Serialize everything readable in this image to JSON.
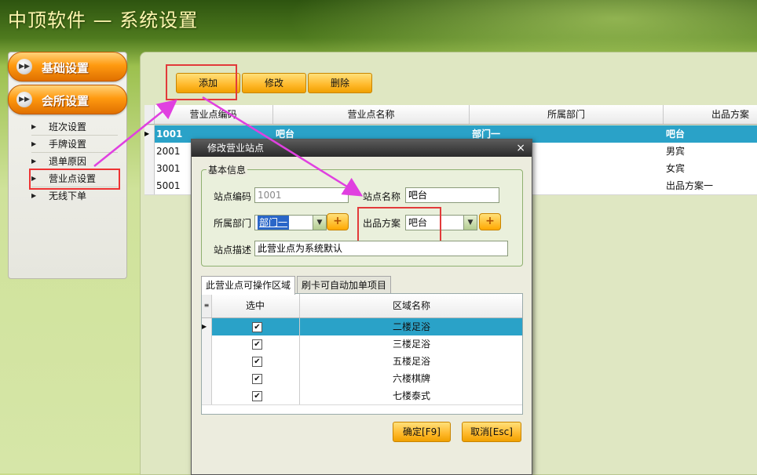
{
  "app": {
    "title": "中顶软件 — 系统设置"
  },
  "sidebar": {
    "groups": [
      {
        "label": "基础设置"
      },
      {
        "label": "会所设置"
      }
    ],
    "items": [
      {
        "label": "班次设置"
      },
      {
        "label": "手牌设置"
      },
      {
        "label": "退单原因"
      },
      {
        "label": "营业点设置"
      },
      {
        "label": "无线下单"
      }
    ]
  },
  "toolbar": {
    "add": "添加",
    "edit": "修改",
    "delete": "删除"
  },
  "grid": {
    "columns": [
      "营业点编码",
      "营业点名称",
      "所属部门",
      "出品方案"
    ],
    "rows": [
      {
        "code": "1001",
        "name": "吧台",
        "dept": "部门一",
        "plan": "吧台"
      },
      {
        "code": "2001",
        "name": "",
        "dept": "",
        "plan": "男宾"
      },
      {
        "code": "3001",
        "name": "",
        "dept": "",
        "plan": "女宾"
      },
      {
        "code": "5001",
        "name": "",
        "dept": "",
        "plan": "出品方案一"
      }
    ]
  },
  "dialog": {
    "title": "修改营业站点",
    "close": "×",
    "group_title": "基本信息",
    "site_code_label": "站点编码",
    "site_code": "1001",
    "site_name_label": "站点名称",
    "site_name": "吧台",
    "dept_label": "所属部门",
    "dept": "部门一",
    "plan_label": "出品方案",
    "plan": "吧台",
    "desc_label": "站点描述",
    "desc": "此营业点为系统默认",
    "plus": "+",
    "tabs": [
      "此营业点可操作区域",
      "刷卡可自动加单项目"
    ],
    "subgrid": {
      "columns": [
        "选中",
        "区域名称"
      ],
      "rows": [
        {
          "checked": true,
          "name": "二楼足浴"
        },
        {
          "checked": true,
          "name": "三楼足浴"
        },
        {
          "checked": true,
          "name": "五楼足浴"
        },
        {
          "checked": true,
          "name": "六楼棋牌"
        },
        {
          "checked": true,
          "name": "七楼泰式"
        }
      ]
    },
    "ok": "确定[F9]",
    "cancel": "取消[Esc]"
  },
  "colors": {
    "accent_orange": "#ff9a10",
    "selection": "#2aa2c8",
    "highlight_red": "#e23a3a",
    "arrow_magenta": "#e040e0"
  }
}
